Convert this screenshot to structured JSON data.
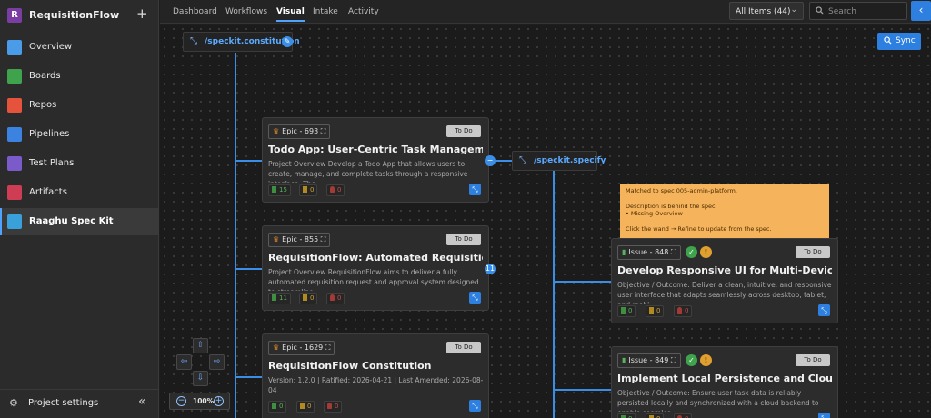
{
  "project": {
    "initial": "R",
    "name": "RequisitionFlow"
  },
  "sidebar": {
    "items": [
      {
        "label": "Overview",
        "icon": "overview-icon",
        "color": "#4a9be8"
      },
      {
        "label": "Boards",
        "icon": "boards-icon",
        "color": "#3fa34d"
      },
      {
        "label": "Repos",
        "icon": "repos-icon",
        "color": "#e5533d"
      },
      {
        "label": "Pipelines",
        "icon": "pipelines-icon",
        "color": "#3c82e0"
      },
      {
        "label": "Test Plans",
        "icon": "test-plans-icon",
        "color": "#7b5bc9"
      },
      {
        "label": "Artifacts",
        "icon": "artifacts-icon",
        "color": "#cf3d55"
      },
      {
        "label": "Raaghu Spec Kit",
        "icon": "spec-kit-icon",
        "color": "#3aa0d9",
        "active": true
      }
    ],
    "settings_label": "Project settings"
  },
  "tabs": [
    "Dashboard",
    "Workflows",
    "Visual",
    "Intake",
    "Activity"
  ],
  "active_tab": "Visual",
  "filter": {
    "label": "All Items (44)"
  },
  "search": {
    "placeholder": "Search"
  },
  "canvas": {
    "sync_label": "Sync",
    "nodes": {
      "constitution": "/speckit.constitution",
      "specify": "/speckit.specify"
    },
    "cards": [
      {
        "tag": "Epic - 693",
        "status": "To Do",
        "title": "Todo App: User-Centric Task Management ...",
        "desc": "Project Overview Develop a Todo App that allows users to create, manage, and complete tasks through a responsive interface. The...",
        "counts": [
          "15",
          "0",
          "0"
        ]
      },
      {
        "tag": "Epic - 855",
        "status": "To Do",
        "title": "RequisitionFlow: Automated Requisition Re...",
        "desc": "Project Overview RequisitionFlow aims to deliver a fully automated requisition request and approval system designed to streamline...",
        "counts": [
          "11",
          "0",
          "0"
        ]
      },
      {
        "tag": "Epic - 1629",
        "status": "To Do",
        "title": "RequisitionFlow Constitution",
        "desc": "Version: 1.2.0 | Ratified: 2026-04-21 | Last Amended: 2026-08-04",
        "counts": [
          "0",
          "0",
          "0"
        ]
      },
      {
        "tag": "Issue - 848",
        "status": "To Do",
        "title": "Develop Responsive UI for Multi-Device Su...",
        "desc": "Objective / Outcome: Deliver a clean, intuitive, and responsive user interface that adapts seamlessly across desktop, tablet, and mobi...",
        "counts": [
          "0",
          "0",
          "0"
        ]
      },
      {
        "tag": "Issue - 849",
        "status": "To Do",
        "title": "Implement Local Persistence and Cloud Syn...",
        "desc": "Objective / Outcome: Ensure user task data is reliably persisted locally and synchronized with a cloud backend to enable seamles...",
        "counts": [
          "0",
          "0",
          "0"
        ]
      }
    ],
    "badge_count": "11",
    "tooltip": {
      "line1": "Matched to spec 005-admin-platform.",
      "line2": "Description is behind the spec.",
      "line3": "• Missing Overview",
      "line4": "Click the wand → Refine to update from the spec."
    },
    "zoom": "100%"
  },
  "colors": {
    "accent": "#2d7fe0",
    "wire": "#3a8ee6",
    "tooltip": "#f5b45c"
  }
}
